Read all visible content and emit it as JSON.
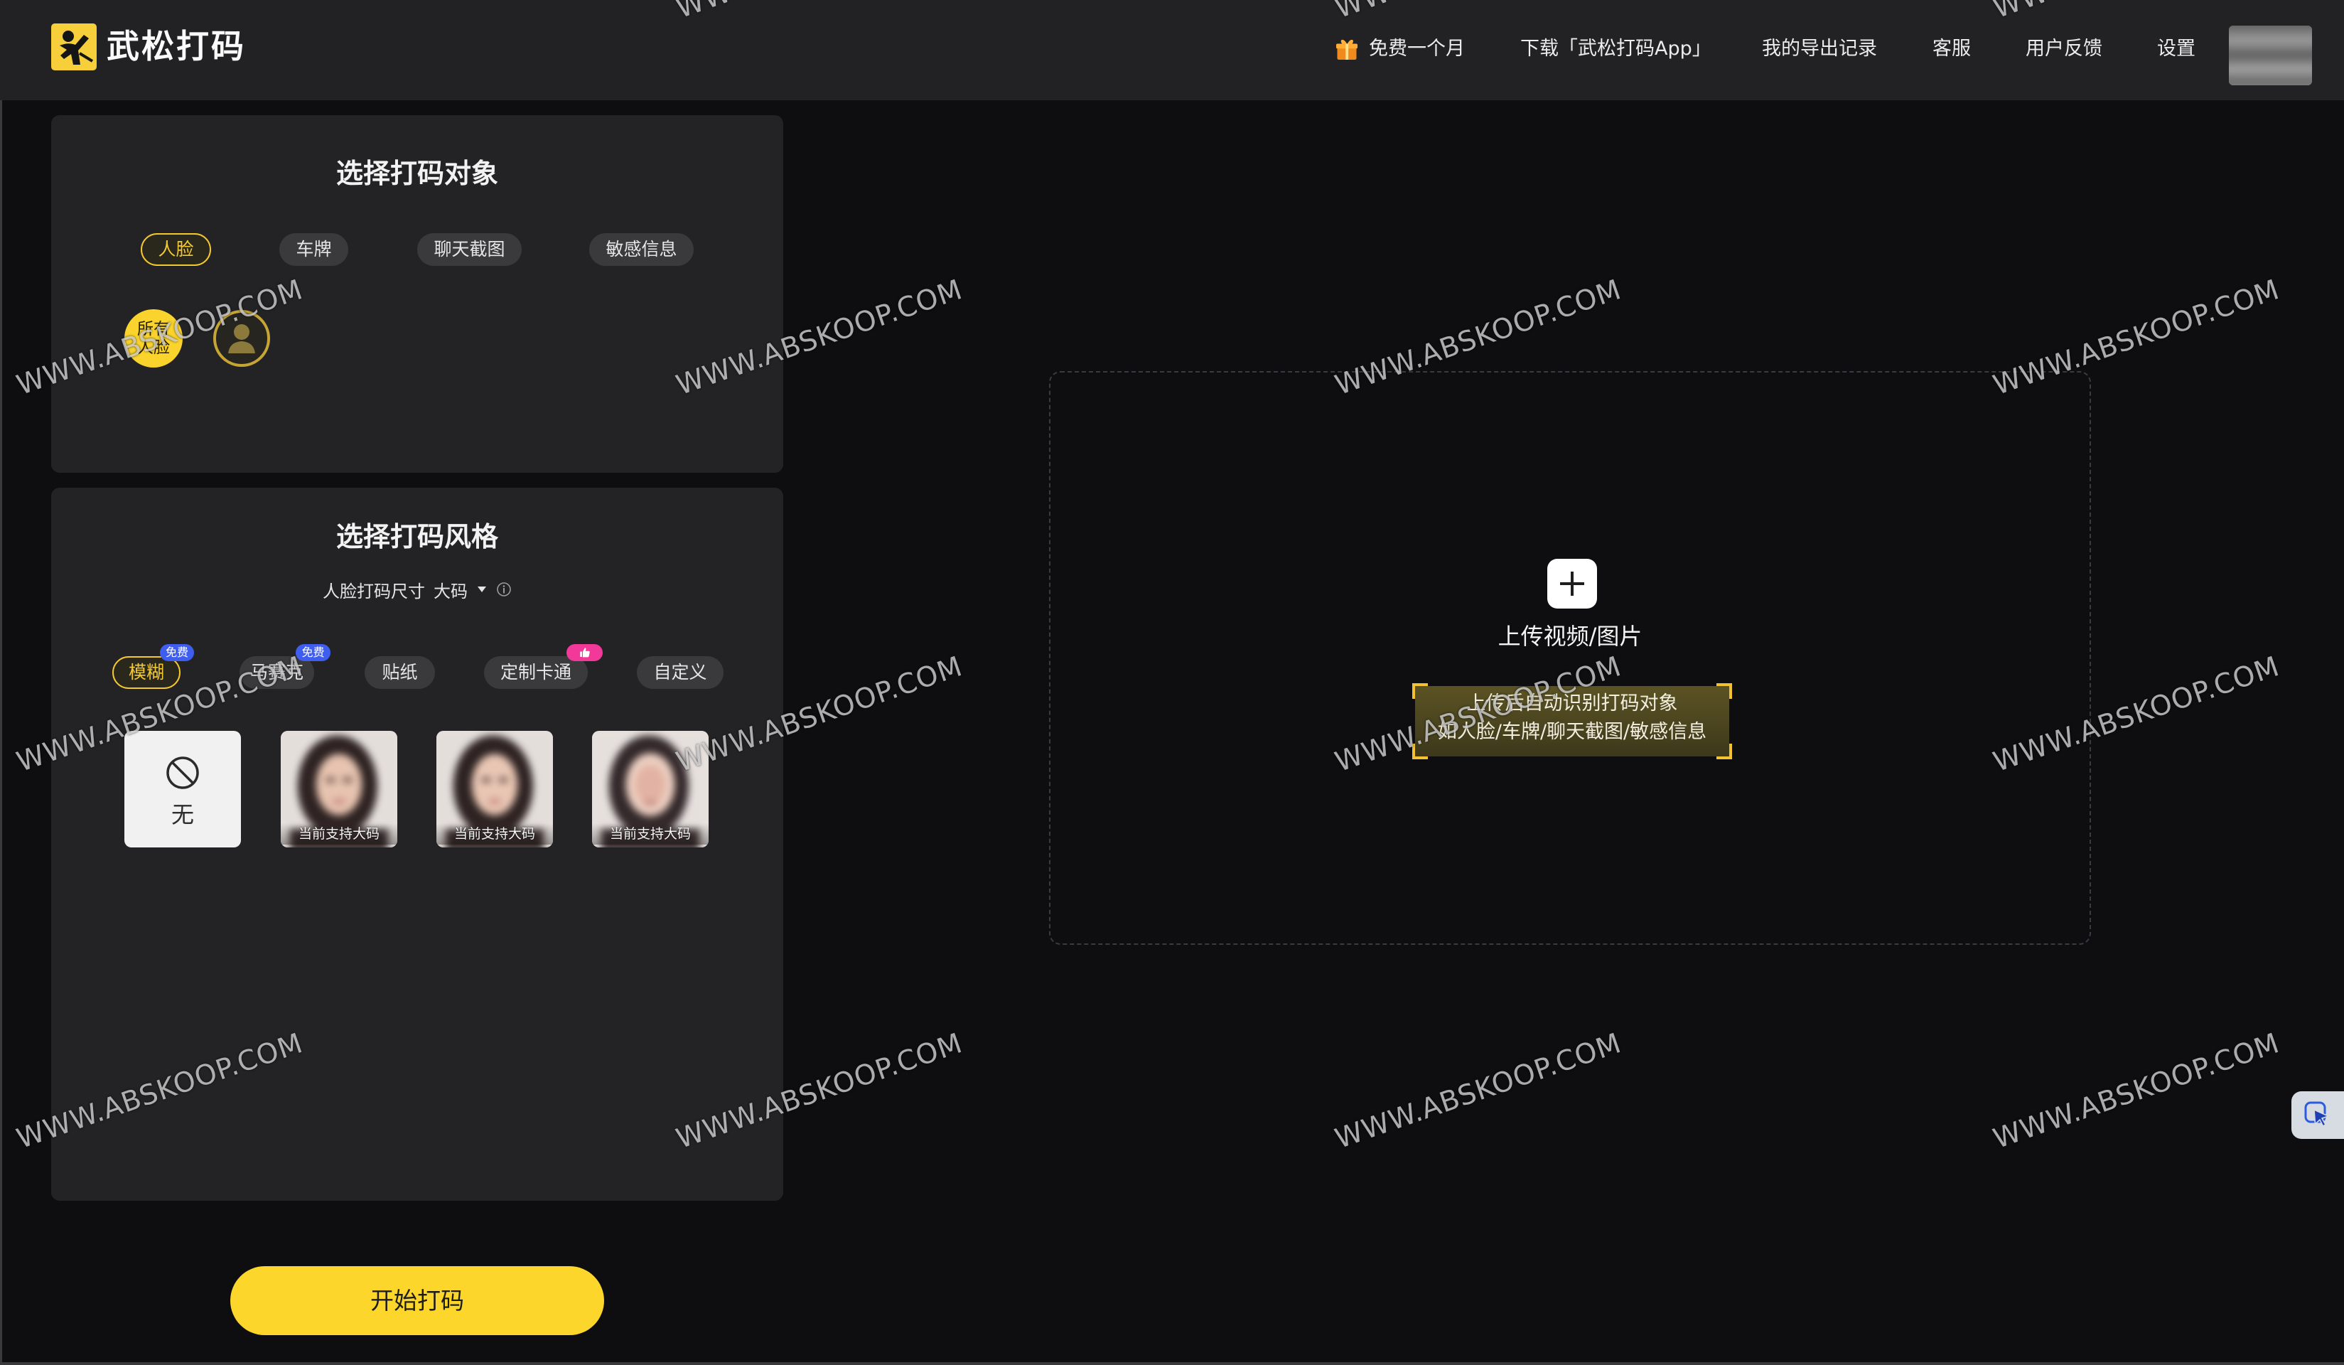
{
  "app": {
    "title": "武松打码",
    "logo_icon": "app-logo-icon"
  },
  "header": {
    "nav": [
      {
        "label": "免费一个月",
        "icon": "gift-icon"
      },
      {
        "label": "下载「武松打码App」"
      },
      {
        "label": "我的导出记录"
      },
      {
        "label": "客服"
      },
      {
        "label": "用户反馈"
      },
      {
        "label": "设置"
      }
    ],
    "avatar_icon": "user-avatar"
  },
  "target_panel": {
    "title": "选择打码对象",
    "tabs": [
      "人脸",
      "车牌",
      "聊天截图",
      "敏感信息"
    ],
    "active_index": 0,
    "faces": [
      {
        "label": "所有人脸",
        "selected": true
      },
      {
        "icon": "person-silhouette-icon",
        "selected": false
      }
    ]
  },
  "style_panel": {
    "title": "选择打码风格",
    "size_label": "人脸打码尺寸",
    "size_value": "大码",
    "tabs": [
      {
        "label": "模糊",
        "badge": "免费"
      },
      {
        "label": "马赛克",
        "badge": "免费"
      },
      {
        "label": "贴纸"
      },
      {
        "label": "定制卡通",
        "badge_icon": "thumbs-up-icon"
      },
      {
        "label": "自定义"
      }
    ],
    "active_index": 0,
    "options": [
      {
        "label": "无",
        "icon": "prohibited-icon"
      },
      {
        "caption": "当前支持大码"
      },
      {
        "caption": "当前支持大码"
      },
      {
        "caption": "当前支持大码"
      }
    ]
  },
  "upload": {
    "icon": "plus-icon",
    "label": "上传视频/图片",
    "hint": [
      "上传后自动识别打码对象",
      "如人脸/车牌/聊天截图/敏感信息"
    ]
  },
  "start_button": {
    "label": "开始打码"
  },
  "floating_tool": {
    "icon": "cursor-click-icon"
  },
  "watermark": {
    "text": "WWW.ABSKOOP.COM"
  },
  "colors": {
    "accent": "#FAD42C",
    "background": "#0E0E11",
    "header": "#222224",
    "panel": "#232325",
    "badge_blue": "#3F5EF0",
    "badge_pink": "#F2399A"
  }
}
